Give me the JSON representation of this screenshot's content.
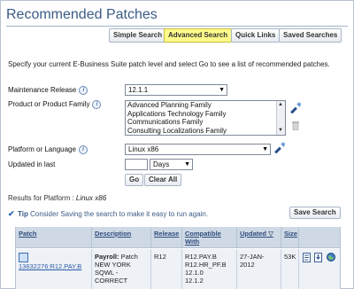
{
  "page": {
    "title": "Recommended Patches"
  },
  "nav": {
    "simple_search": "Simple Search",
    "advanced_search": "Advanced Search",
    "quick_links": "Quick Links",
    "saved_searches": "Saved Searches"
  },
  "intro": "Specify your current E-Business Suite patch level and select Go to see a list of recommended patches.",
  "form": {
    "maintenance_release": {
      "label": "Maintenance Release",
      "value": "12.1.1"
    },
    "product_family": {
      "label": "Product or Product Family",
      "options": [
        "Advanced Planning Family",
        "Applications Technology Family",
        "Communications Family",
        "Consulting Localizations Family"
      ]
    },
    "platform": {
      "label": "Platform or Language",
      "value": "Linux x86"
    },
    "updated_in_last": {
      "label": "Updated in last",
      "value": "",
      "unit": "Days"
    },
    "go": "Go",
    "clear_all": "Clear All"
  },
  "results": {
    "label": "Results for Platform :",
    "platform": "Linux x86",
    "tip_label": "Tip",
    "tip_text": "Consider Saving the search to make it easy to run again.",
    "save_search": "Save Search"
  },
  "table": {
    "headers": {
      "patch": "Patch",
      "description": "Description",
      "release": "Release",
      "compatible": "Compatible With",
      "updated": "Updated",
      "size": "Size"
    },
    "rows": [
      {
        "patch": "13632276:R12.PAY.B",
        "description_bold": "Payroll:",
        "description": "Patch NEW YORK SQWL - CORRECT",
        "release": "R12",
        "compatible": [
          "R12.PAY.B",
          "R12.HR_PF.B",
          "12.1.0",
          "12.1.2"
        ],
        "updated": "27-JAN-2012",
        "size": "53K"
      }
    ]
  },
  "colors": {
    "active_tab": "#fffb8a",
    "title": "#3b5a86",
    "table_header": "#cfd9e6"
  }
}
